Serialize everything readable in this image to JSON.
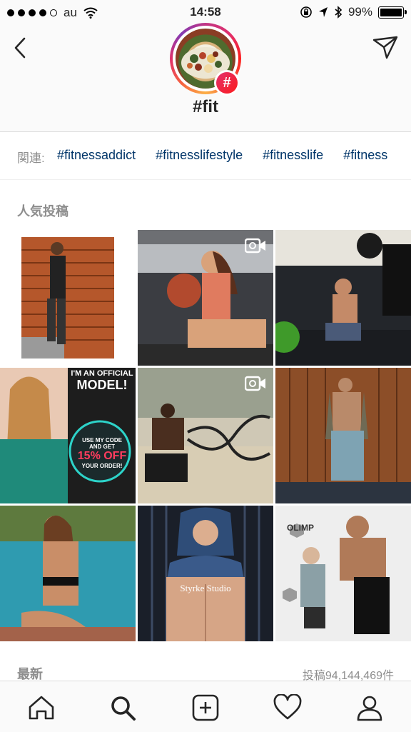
{
  "status_bar": {
    "carrier": "au",
    "time": "14:58",
    "battery": "99%",
    "battery_level": 0.99
  },
  "header": {
    "title": "#fit",
    "badge_symbol": "#",
    "back_icon": "chevron-left-icon",
    "send_icon": "paper-plane-icon"
  },
  "related": {
    "label": "関連:",
    "tags": [
      "#fitnessaddict",
      "#fitnesslifestyle",
      "#fitnesslife",
      "#fitness"
    ]
  },
  "sections": {
    "top_posts": "人気投稿",
    "recent": "最新",
    "post_count": "投稿94,144,469件"
  },
  "posts": [
    {
      "description": "woman leaning on wooden wall",
      "is_video": false
    },
    {
      "description": "woman squatting with medicine ball",
      "is_video": true
    },
    {
      "description": "man doing kettlebell squat",
      "is_video": false
    },
    {
      "description": "model promo collage",
      "is_video": false,
      "promo_text": [
        "I'M AN OFFICIAL",
        "MODEL!",
        "USE MY CODE",
        "AND GET",
        "15% OFF",
        "YOUR ORDER!"
      ]
    },
    {
      "description": "man with battle ropes",
      "is_video": true
    },
    {
      "description": "man in open jacket by wooden wall",
      "is_video": false
    },
    {
      "description": "woman by swimming pool",
      "is_video": false
    },
    {
      "description": "muscular man in hood",
      "is_video": false,
      "watermark": "Styrke Studio"
    },
    {
      "description": "two men at fitness expo",
      "is_video": false,
      "brand_text": "OLIMP"
    }
  ],
  "tabbar": [
    "home-icon",
    "search-icon",
    "add-icon",
    "heart-icon",
    "profile-icon"
  ],
  "colors": {
    "hashtag": "#003569",
    "muted": "#8e8e8e",
    "badge": "#e1306c"
  }
}
